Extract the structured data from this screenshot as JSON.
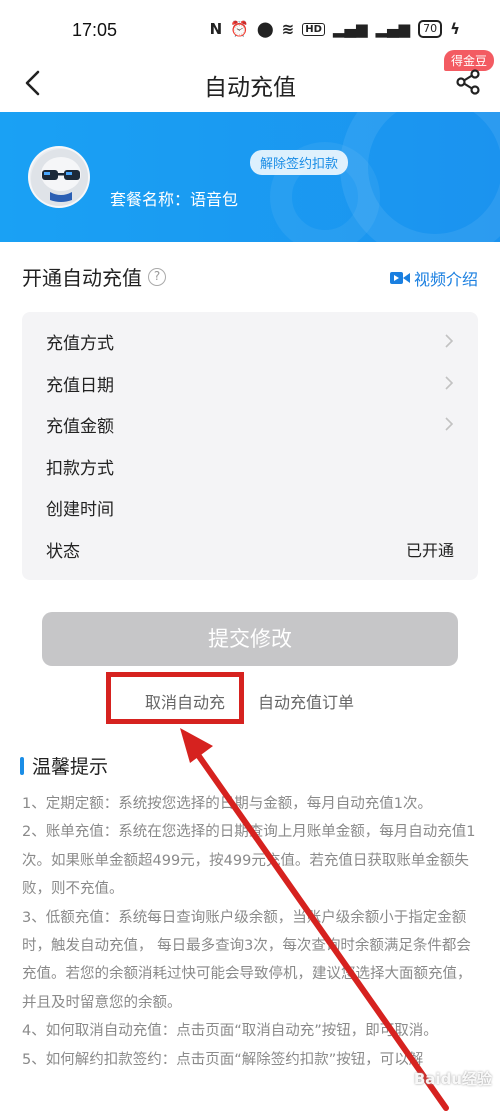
{
  "status_bar": {
    "time": "17:05",
    "icons": [
      "nfc-icon",
      "alarm-icon",
      "location-icon",
      "wifi-icon",
      "hd-icon",
      "signal-icon",
      "signal-icon"
    ],
    "battery": "70"
  },
  "nav": {
    "title": "自动充值",
    "badge": "得金豆"
  },
  "banner": {
    "unsign_label": "解除签约扣款",
    "plan_name": "套餐名称：语音包"
  },
  "section": {
    "title": "开通自动充值",
    "video_label": "视频介绍"
  },
  "info_rows": [
    {
      "label": "充值方式",
      "value": "",
      "chevron": true
    },
    {
      "label": "充值日期",
      "value": "",
      "chevron": true
    },
    {
      "label": "充值金额",
      "value": "",
      "chevron": true
    },
    {
      "label": "扣款方式",
      "value": "",
      "chevron": false
    },
    {
      "label": "创建时间",
      "value": "",
      "chevron": false
    },
    {
      "label": "状态",
      "value": "已开通",
      "chevron": false
    }
  ],
  "submit_label": "提交修改",
  "links": {
    "cancel": "取消自动充",
    "orders": "自动充值订单"
  },
  "tips": {
    "title": "温馨提示",
    "items": [
      "1、定期定额：系统按您选择的日期与金额，每月自动充值1次。",
      "2、账单充值：系统在您选择的日期查询上月账单金额，每月自动充值1次。如果账单金额超499元，按499元充值。若充值日获取账单金额失败，则不充值。",
      "3、低额充值：系统每日查询账户级余额，当账户级余额小于指定金额时，触发自动充值， 每日最多查询3次，每次查询时余额满足条件都会充值。若您的余额消耗过快可能会导致停机，建议您选择大面额充值，并且及时留意您的余额。",
      "4、如何取消自动充值：点击页面“取消自动充”按钮，即可取消。",
      "5、如何解约扣款签约：点击页面“解除签约扣款”按钮，可以解"
    ]
  },
  "watermark": "Baidu经验",
  "colors": {
    "accent": "#1a8de6",
    "banner": "#1aa1f4",
    "highlight": "#d6221f",
    "badge": "#f35b62"
  }
}
